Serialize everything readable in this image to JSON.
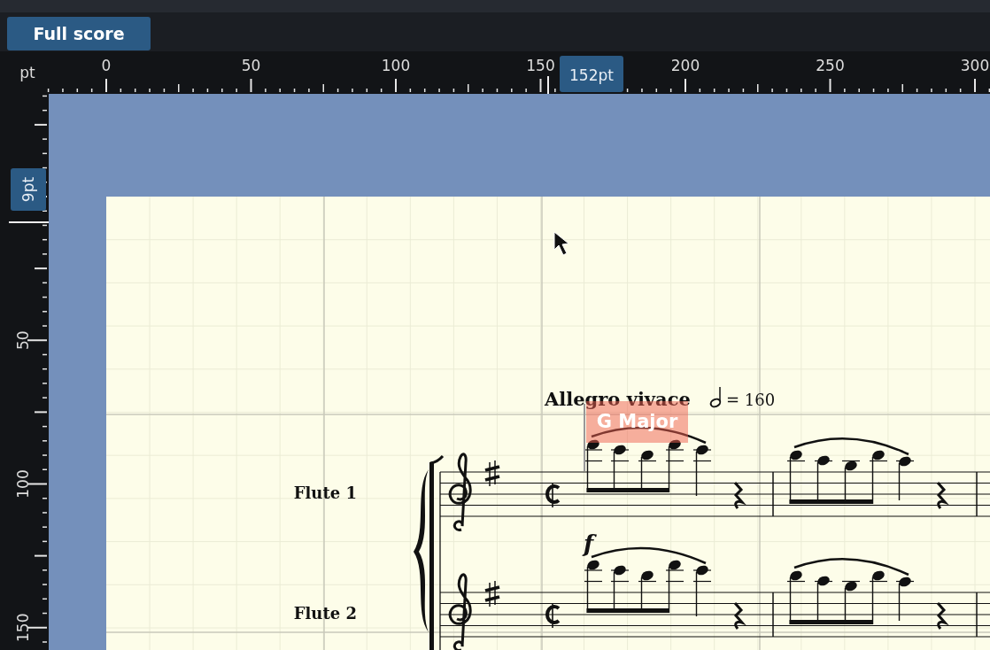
{
  "tabs": [
    {
      "label": "Full score",
      "selected": true
    }
  ],
  "horizontal_ruler": {
    "unit": "pt",
    "labels": [
      "0",
      "50",
      "100",
      "150",
      "200",
      "250",
      "300"
    ],
    "readout": "152pt"
  },
  "vertical_ruler": {
    "labels": [
      "50",
      "100",
      "150"
    ],
    "readout": "9pt"
  },
  "score": {
    "tempo": "Allegro vivace",
    "metronome": "= 160",
    "key_popup": "G Major",
    "staves": [
      {
        "name": "Flute 1"
      },
      {
        "name": "Flute 2",
        "dynamic": "f"
      }
    ]
  }
}
